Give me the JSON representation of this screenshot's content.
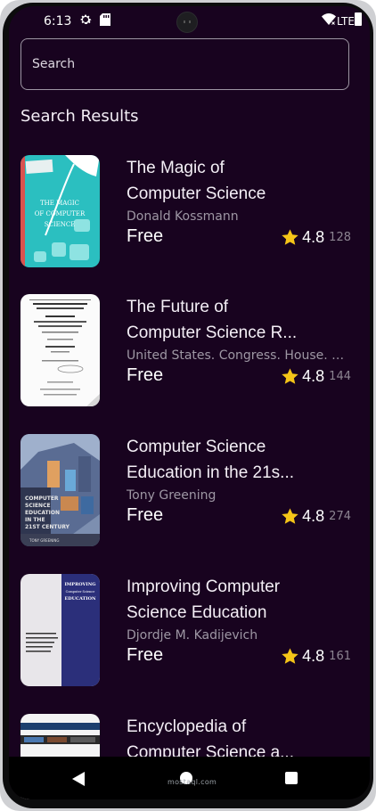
{
  "status_bar": {
    "time": "6:13",
    "network": "LTE"
  },
  "search": {
    "placeholder": "Search"
  },
  "section_title": "Search Results",
  "books": [
    {
      "title_line1": "The Magic of",
      "title_line2": "Computer Science",
      "author": "Donald Kossmann",
      "price": "Free",
      "rating": "4.8",
      "reviews": "128"
    },
    {
      "title_line1": "The Future of",
      "title_line2": "Computer Science R...",
      "author": "United States. Congress. House. C...",
      "price": "Free",
      "rating": "4.8",
      "reviews": "144"
    },
    {
      "title_line1": "Computer Science",
      "title_line2": "Education in the 21s...",
      "author": "Tony Greening",
      "price": "Free",
      "rating": "4.8",
      "reviews": "274"
    },
    {
      "title_line1": "Improving Computer",
      "title_line2": "Science Education",
      "author": "Djordje M. Kadijevich",
      "price": "Free",
      "rating": "4.8",
      "reviews": "161"
    },
    {
      "title_line1": "Encyclopedia of",
      "title_line2": "Computer Science a...",
      "author": "",
      "price": "",
      "rating": "",
      "reviews": ""
    }
  ],
  "covers": {
    "book1": {
      "text": "THE MAGIC OF COMPUTER SCIENCE",
      "label": "Donald Kossmann"
    },
    "book2": {
      "text": "THE FUTURE OF COMPUTER SCIENCE RESEARCH IN THE U.S."
    },
    "book3": {
      "text": "COMPUTER SCIENCE EDUCATION IN THE 21ST CENTURY",
      "label": "TONY GREENING"
    },
    "book4": {
      "text": "IMPROVING Computer Science EDUCATION"
    }
  },
  "watermark": "mostaql.com",
  "colors": {
    "background": "#18031f",
    "star": "#f5c518",
    "author": "#9e97a4"
  }
}
